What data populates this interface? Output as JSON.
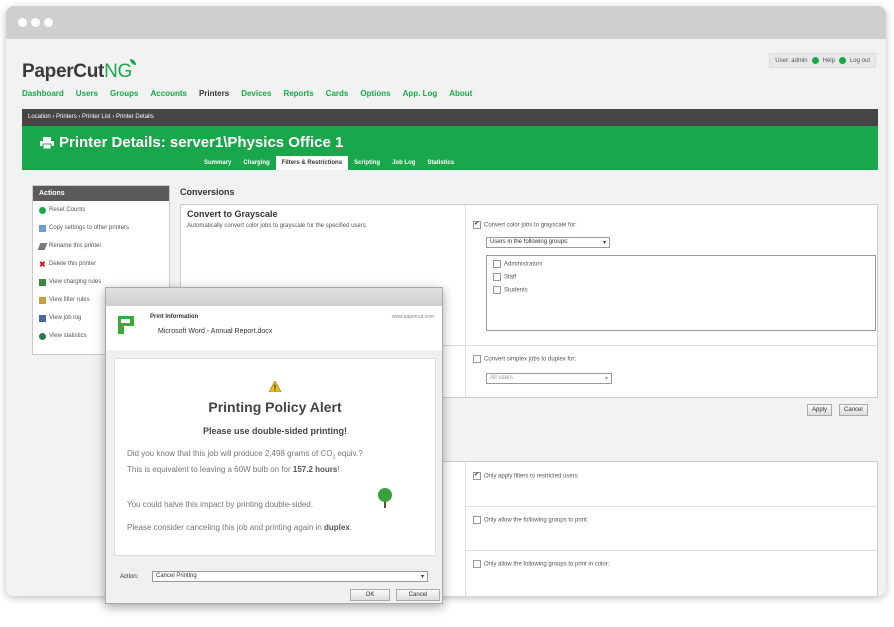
{
  "app": {
    "logo_prefix": "PaperCut",
    "logo_suffix": "NG",
    "user_text": "User: admin",
    "help_label": "Help",
    "logout_label": "Log out"
  },
  "nav": [
    "Dashboard",
    "Users",
    "Groups",
    "Accounts",
    "Printers",
    "Devices",
    "Reports",
    "Cards",
    "Options",
    "App. Log",
    "About"
  ],
  "nav_active": "Printers",
  "breadcrumb": "Location › Printers › Printer List › Printer Details",
  "page_title": "Printer Details: server1\\Physics Office 1",
  "subtabs": [
    "Summary",
    "Charging",
    "Filters & Restrictions",
    "Scripting",
    "Job Log",
    "Statistics"
  ],
  "subtab_active": "Filters & Restrictions",
  "actions": {
    "title": "Actions",
    "items": [
      {
        "label": "Reset Counts",
        "icon": "reset-icon"
      },
      {
        "label": "Copy settings to other printers",
        "icon": "copy-icon"
      },
      {
        "label": "Rename this printer",
        "icon": "pencil-icon"
      },
      {
        "label": "Delete this printer",
        "icon": "delete-icon"
      },
      {
        "label": "View charging rules",
        "icon": "printer-icon"
      },
      {
        "label": "View filter rules",
        "icon": "filter-icon"
      },
      {
        "label": "View job log",
        "icon": "log-icon"
      },
      {
        "label": "View statistics",
        "icon": "stats-icon"
      }
    ]
  },
  "conversions": {
    "heading": "Conversions",
    "grayscale": {
      "title": "Convert to Grayscale",
      "desc": "Automatically convert color jobs to grayscale for the specified users.",
      "checkbox_label": "Convert color jobs to grayscale for:",
      "select_value": "Users in the following groups:",
      "groups": [
        "Administrators",
        "Staff",
        "Students"
      ]
    },
    "duplex": {
      "checkbox_label": "Convert simplex jobs to duplex for:",
      "select_value": "All users"
    },
    "apply_label": "Apply",
    "cancel_label": "Cancel"
  },
  "filters": {
    "restricted_label": "Only apply filters to restricted users",
    "groups_print_label": "Only allow the following groups to print:",
    "groups_color_label": "Only allow the following groups to print in color:"
  },
  "dialog": {
    "info_title": "Print Information",
    "document": "Microsoft Word - Annual Report.docx",
    "site": "www.papercut.com",
    "alert_title": "Printing Policy Alert",
    "alert_sub": "Please use double-sided printing!",
    "line1_pre": "Did you know that this job will produce 2,498 grams of CO",
    "line1_sub": "2",
    "line1_post": " equiv.?",
    "line2_pre": "This is equivalent to leaving a 60W bulb on for ",
    "line2_bold": "157.2 hours",
    "line2_post": "!",
    "line3": "You could halve this impact by printing double-sided.",
    "line4_pre": "Please consider canceling this job and printing again in ",
    "line4_bold": "duplex",
    "line4_post": ".",
    "action_label": "Action:",
    "action_value": "Cancel Printing",
    "ok_label": "OK",
    "cancel_label": "Cancel"
  },
  "colors": {
    "brand_green": "#1aa64b",
    "dark_bar": "#454545"
  }
}
